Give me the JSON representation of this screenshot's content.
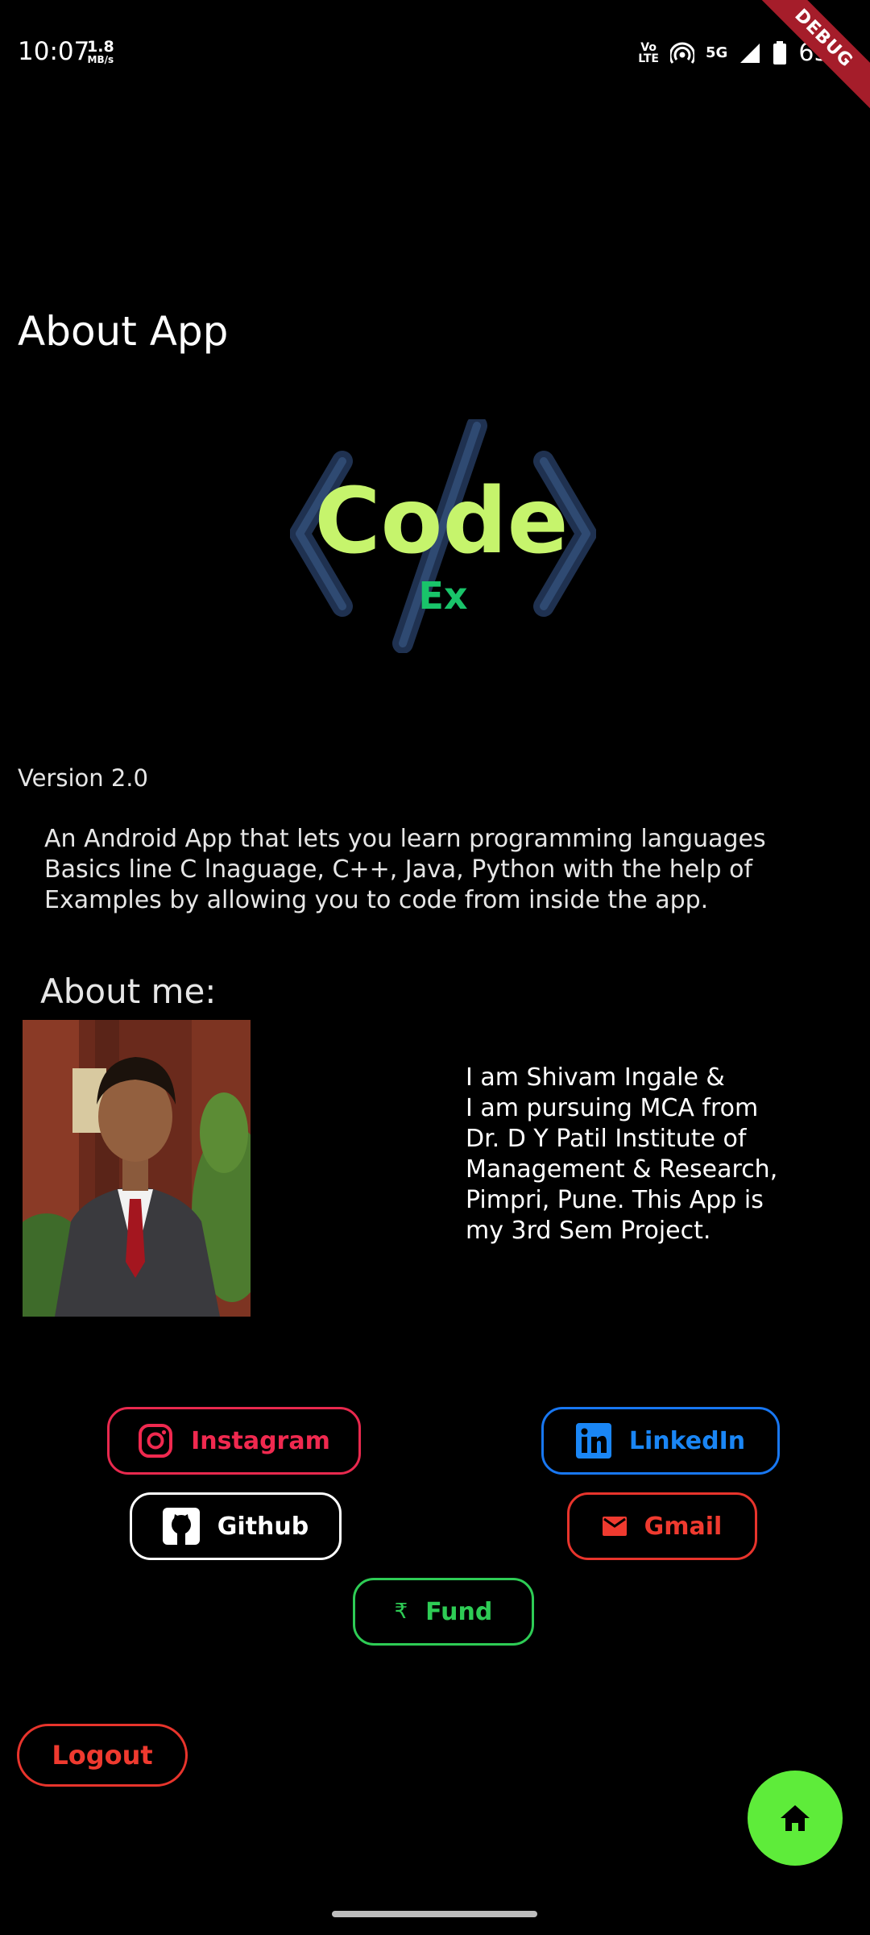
{
  "status_bar": {
    "time": "10:07",
    "speed_value": "1.8",
    "speed_unit": "MB/s",
    "volte_top": "Vo",
    "volte_bottom": "LTE",
    "network": "5G",
    "battery": "65%",
    "debug_label": "DEBUG"
  },
  "page": {
    "title": "About App",
    "logo_text": "Code",
    "logo_sub": "Ex",
    "version": "Version 2.0",
    "description": "An Android App that lets you learn programming languages Basics line C lnaguage, C++, Java, Python with the help of Examples by allowing you to code from inside the app.",
    "about_heading": "About me:",
    "bio": "I am  Shivam Ingale &\nI am pursuing MCA from\nDr. D Y Patil Institute of\nManagement & Research,\nPimpri, Pune. This App is\nmy 3rd Sem Project."
  },
  "links": {
    "instagram": "Instagram",
    "linkedin": "LinkedIn",
    "github": "Github",
    "gmail": "Gmail",
    "fund": "Fund",
    "fund_symbol": "₹"
  },
  "actions": {
    "logout": "Logout"
  },
  "icons": {
    "fab": "home-icon"
  },
  "colors": {
    "background": "#000000",
    "instagram": "#f0294f",
    "linkedin": "#1a86f5",
    "gmail": "#ef3a2f",
    "fund": "#2ecc55",
    "fab": "#5eec3a",
    "logo_main": "#c6f46c",
    "logo_sub": "#19c46a"
  }
}
